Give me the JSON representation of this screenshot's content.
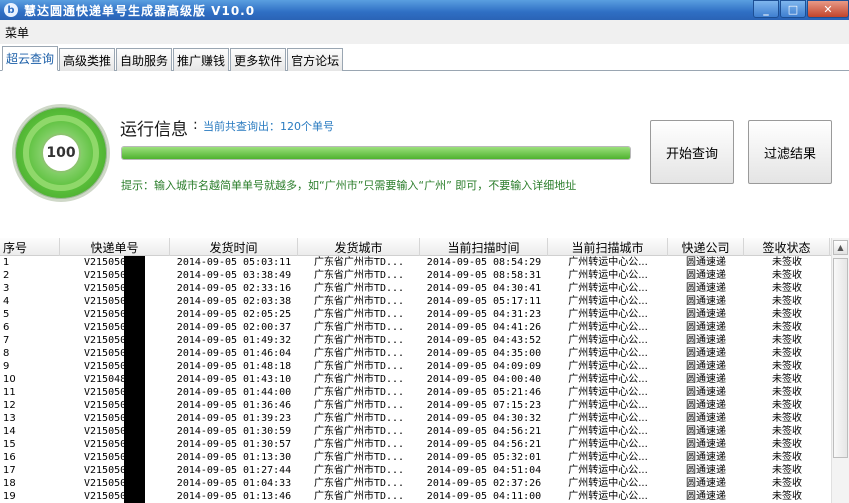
{
  "window": {
    "title": "慧达圆通快递单号生成器高级版 V10.0",
    "icon_glyph": "b",
    "controls": {
      "minimize": "_",
      "maximize": "□",
      "close": "✕"
    }
  },
  "menu": {
    "label": "菜单"
  },
  "tabs": [
    {
      "label": "超云查询",
      "active": true
    },
    {
      "label": "高级类推",
      "active": false
    },
    {
      "label": "自助服务",
      "active": false
    },
    {
      "label": "推广赚钱",
      "active": false
    },
    {
      "label": "更多软件",
      "active": false
    },
    {
      "label": "官方论坛",
      "active": false
    }
  ],
  "gauge": {
    "value": "100"
  },
  "run_info": {
    "label": "运行信息",
    "colon": ":",
    "status": "当前共查询出：120个单号",
    "progress_fraction": 1.0
  },
  "tip": "提示：输入城市名越简单单号就越多，如“广州市”只需要输入“广州” 即可，不要输入详细地址",
  "buttons": {
    "start": "开始查询",
    "filter": "过滤结果"
  },
  "table": {
    "columns": [
      "序号",
      "快递单号",
      "发货时间",
      "发货城市",
      "当前扫描时间",
      "当前扫描城市",
      "快递公司",
      "签收状态"
    ],
    "rows": [
      [
        "1",
        "V215050",
        "2014-09-05 05:03:11",
        "广东省广州市TD...",
        "2014-09-05 08:54:29",
        "广州转运中心公...",
        "圆通速递",
        "未签收"
      ],
      [
        "2",
        "V215050",
        "2014-09-05 03:38:49",
        "广东省广州市TD...",
        "2014-09-05 08:58:31",
        "广州转运中心公...",
        "圆通速递",
        "未签收"
      ],
      [
        "3",
        "V215050",
        "2014-09-05 02:33:16",
        "广东省广州市TD...",
        "2014-09-05 04:30:41",
        "广州转运中心公...",
        "圆通速递",
        "未签收"
      ],
      [
        "4",
        "V215050",
        "2014-09-05 02:03:38",
        "广东省广州市TD...",
        "2014-09-05 05:17:11",
        "广州转运中心公...",
        "圆通速递",
        "未签收"
      ],
      [
        "5",
        "V215050",
        "2014-09-05 02:05:25",
        "广东省广州市TD...",
        "2014-09-05 04:31:23",
        "广州转运中心公...",
        "圆通速递",
        "未签收"
      ],
      [
        "6",
        "V215050",
        "2014-09-05 02:00:37",
        "广东省广州市TD...",
        "2014-09-05 04:41:26",
        "广州转运中心公...",
        "圆通速递",
        "未签收"
      ],
      [
        "7",
        "V215050",
        "2014-09-05 01:49:32",
        "广东省广州市TD...",
        "2014-09-05 04:43:52",
        "广州转运中心公...",
        "圆通速递",
        "未签收"
      ],
      [
        "8",
        "V215050",
        "2014-09-05 01:46:04",
        "广东省广州市TD...",
        "2014-09-05 04:35:00",
        "广州转运中心公...",
        "圆通速递",
        "未签收"
      ],
      [
        "9",
        "V215050",
        "2014-09-05 01:48:18",
        "广东省广州市TD...",
        "2014-09-05 04:09:09",
        "广州转运中心公...",
        "圆通速递",
        "未签收"
      ],
      [
        "10",
        "V215048",
        "2014-09-05 01:43:10",
        "广东省广州市TD...",
        "2014-09-05 04:00:40",
        "广州转运中心公...",
        "圆通速递",
        "未签收"
      ],
      [
        "11",
        "V215050",
        "2014-09-05 01:44:00",
        "广东省广州市TD...",
        "2014-09-05 05:21:46",
        "广州转运中心公...",
        "圆通速递",
        "未签收"
      ],
      [
        "12",
        "V215050",
        "2014-09-05 01:36:46",
        "广东省广州市TD...",
        "2014-09-05 07:15:23",
        "广州转运中心公...",
        "圆通速递",
        "未签收"
      ],
      [
        "13",
        "V215050",
        "2014-09-05 01:39:23",
        "广东省广州市TD...",
        "2014-09-05 04:30:32",
        "广州转运中心公...",
        "圆通速递",
        "未签收"
      ],
      [
        "14",
        "V215050",
        "2014-09-05 01:30:59",
        "广东省广州市TD...",
        "2014-09-05 04:56:21",
        "广州转运中心公...",
        "圆通速递",
        "未签收"
      ],
      [
        "15",
        "V215050",
        "2014-09-05 01:30:57",
        "广东省广州市TD...",
        "2014-09-05 04:56:21",
        "广州转运中心公...",
        "圆通速递",
        "未签收"
      ],
      [
        "16",
        "V215050",
        "2014-09-05 01:13:30",
        "广东省广州市TD...",
        "2014-09-05 05:32:01",
        "广州转运中心公...",
        "圆通速递",
        "未签收"
      ],
      [
        "17",
        "V215050",
        "2014-09-05 01:27:44",
        "广东省广州市TD...",
        "2014-09-05 04:51:04",
        "广州转运中心公...",
        "圆通速递",
        "未签收"
      ],
      [
        "18",
        "V215050",
        "2014-09-05 01:04:33",
        "广东省广州市TD...",
        "2014-09-05 02:37:26",
        "广州转运中心公...",
        "圆通速递",
        "未签收"
      ],
      [
        "19",
        "V215050",
        "2014-09-05 01:13:46",
        "广东省广州市TD...",
        "2014-09-05 04:11:00",
        "广州转运中心公...",
        "圆通速递",
        "未签收"
      ]
    ]
  },
  "colors": {
    "title_bar": "#2f6fc4",
    "accent_blue": "#2a7bc0",
    "tip_green": "#2a7d2a",
    "gauge_green": "#5ac03b"
  }
}
